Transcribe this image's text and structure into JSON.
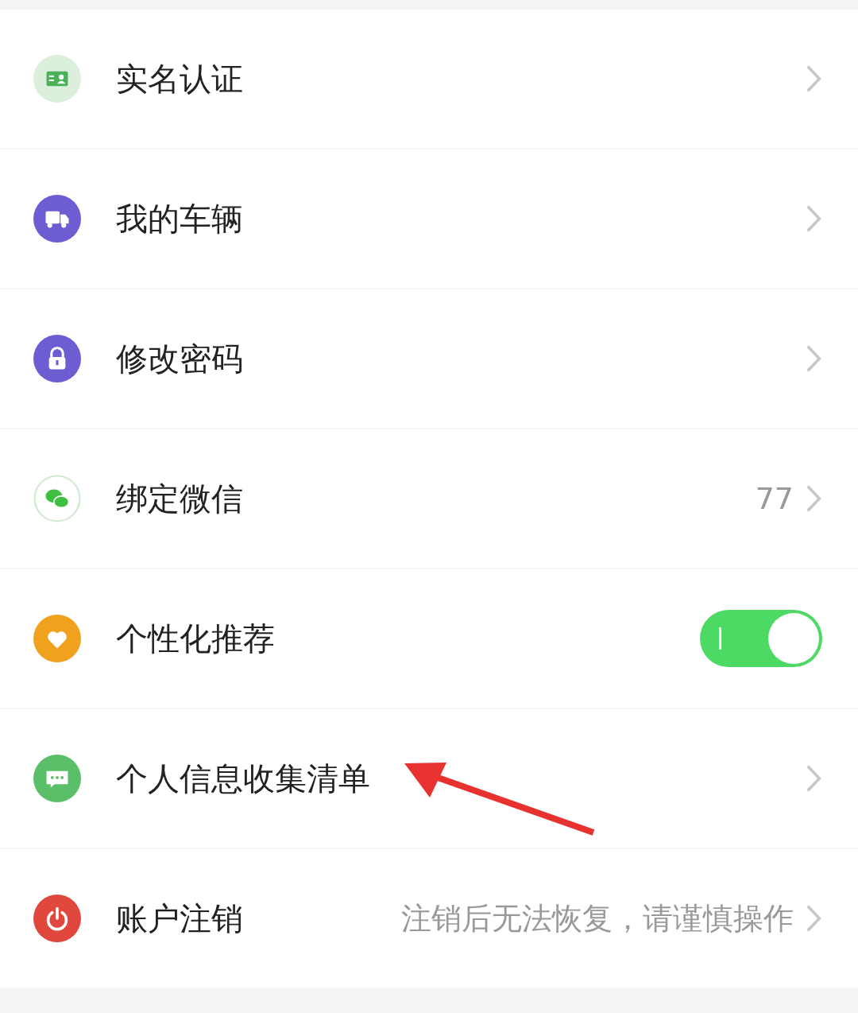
{
  "items": [
    {
      "kind": "link",
      "color": "#dcefdc",
      "label": "实名认证"
    },
    {
      "kind": "link",
      "color": "#6c5dd3",
      "label": "我的车辆"
    },
    {
      "kind": "link",
      "color": "#6c5dd3",
      "label": "修改密码"
    },
    {
      "kind": "link",
      "color": "#cfe8cf",
      "label": "绑定微信",
      "value": "77"
    },
    {
      "kind": "toggle",
      "color": "#f0a21e",
      "label": "个性化推荐",
      "on": true
    },
    {
      "kind": "link",
      "color": "#5bbf6a",
      "label": "个人信息收集清单"
    },
    {
      "kind": "link",
      "color": "#e0473d",
      "label": "账户注销",
      "value": "注销后无法恢复，请谨慎操作"
    }
  ],
  "annotation": {
    "kind": "arrow"
  }
}
